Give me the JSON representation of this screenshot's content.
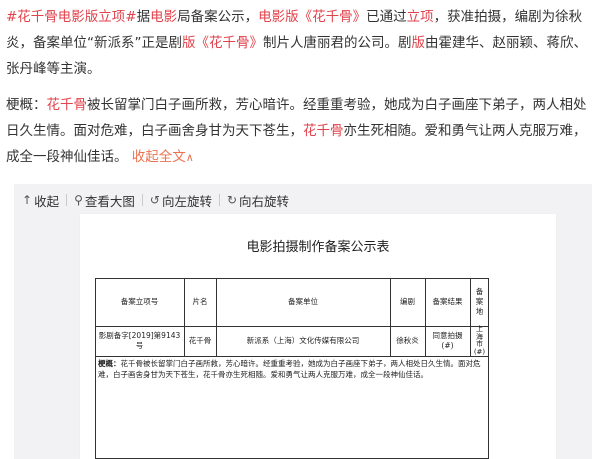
{
  "post": {
    "p1": {
      "t0": "#花千骨电影版立项#",
      "t1": "据",
      "t2": "电影",
      "t3": "局备案公示，",
      "t4": "电影版《花千骨》",
      "t5": "已通过",
      "t6": "立项",
      "t7": "，获准拍摄，编剧为徐秋炎，备案单位“新派系”正是剧",
      "t8": "版《花千骨》",
      "t9": "制片人唐丽君的公司。剧",
      "t10": "版",
      "t11": "由霍建华、赵丽颖、蒋欣、张丹峰等主演。"
    },
    "p2": {
      "t0": "梗概：",
      "t1": "花千骨",
      "t2": "被长留掌门白子画所救，芳心暗许。经重重考验，她成为白子画座下弟子，两人相处日久生情。面对危难，白子画舍身甘为天下苍生，",
      "t3": "花千骨",
      "t4": "亦生死相随。爱和勇气让两人克服万难，成全一段神仙佳话。",
      "fold": "收起全文",
      "fold_icon": "∧"
    }
  },
  "toolbar": {
    "collapse": {
      "icon": "↑",
      "label": "收起"
    },
    "view_large": {
      "icon": "⚲",
      "label": "查看大图"
    },
    "rotate_left": {
      "icon": "↺",
      "label": "向左旋转"
    },
    "rotate_right": {
      "icon": "↻",
      "label": "向右旋转"
    }
  },
  "document": {
    "title": "电影拍摄制作备案公示表",
    "headers": {
      "record_no": "备案立项号",
      "film": "片名",
      "unit": "备案单位",
      "writer": "编剧",
      "result": "备案结果",
      "place_chars": [
        "备",
        "案",
        "地"
      ]
    },
    "row": {
      "record_no": "影剧备字[2019]第9143号",
      "film": "花千骨",
      "unit": "新派系（上海）文化传媒有限公司",
      "writer": "徐秋炎",
      "result_l1": "同意拍摄",
      "result_l2": "(#)",
      "place_chars": [
        "上",
        "海",
        "市",
        "(#)"
      ]
    },
    "summary": {
      "label": "梗概：",
      "text": "花千骨被长留掌门白子画所救，芳心暗许。经重重考验，她成为白子画座下弟子，两人相处日久生情。面对危难，白子画舍身甘为天下苍生，花千骨亦生死相随。爱和勇气让两人克服万难，成全一段神仙佳话。"
    }
  }
}
